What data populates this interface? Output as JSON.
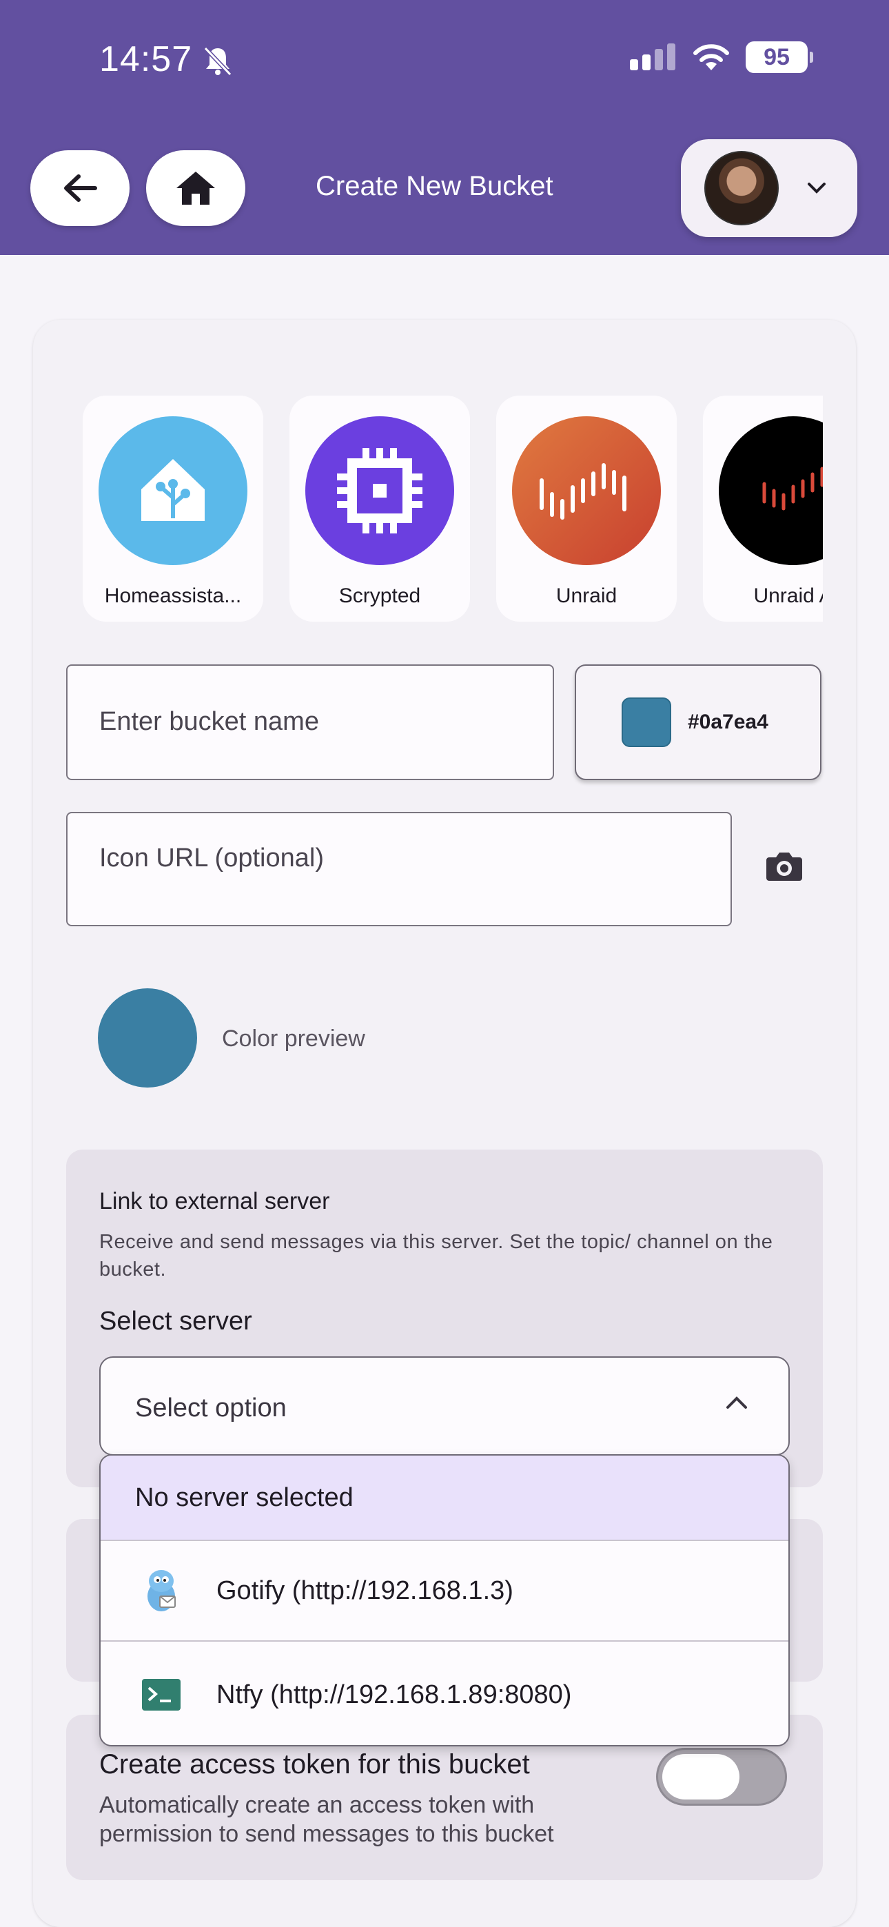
{
  "status_bar": {
    "time": "14:57",
    "battery": "95"
  },
  "header": {
    "title": "Create New Bucket"
  },
  "icon_templates": [
    {
      "label": "Homeassista...",
      "color": "#5bb9ea",
      "icon": "home-assistant-icon"
    },
    {
      "label": "Scrypted",
      "color": "#6b3fe0",
      "icon": "chip-icon"
    },
    {
      "label": "Unraid",
      "color": "#d8503a",
      "icon": "unraid-icon"
    },
    {
      "label": "Unraid A",
      "color": "#000000",
      "icon": "unraid-alt-icon"
    }
  ],
  "form": {
    "bucket_name_placeholder": "Enter bucket name",
    "color_value": "#0a7ea4",
    "icon_url_placeholder": "Icon URL (optional)",
    "color_preview_label": "Color preview"
  },
  "server_section": {
    "title": "Link to external server",
    "description": "Receive and send messages via this server. Set the topic/ channel on the bucket.",
    "select_label": "Select server",
    "select_value": "Select option",
    "options": [
      {
        "label": "No server selected",
        "selected": true
      },
      {
        "label": "Gotify (http://192.168.1.3)",
        "icon": "gotify-icon"
      },
      {
        "label": "Ntfy (http://192.168.1.89:8080)",
        "icon": "terminal-icon"
      }
    ]
  },
  "token_section": {
    "title": "Create access token for this bucket",
    "description": "Automatically create an access token with permission to send messages to this bucket",
    "enabled": false
  },
  "colors": {
    "accent": "#6250a0",
    "bucket": "#3a7fa3"
  }
}
